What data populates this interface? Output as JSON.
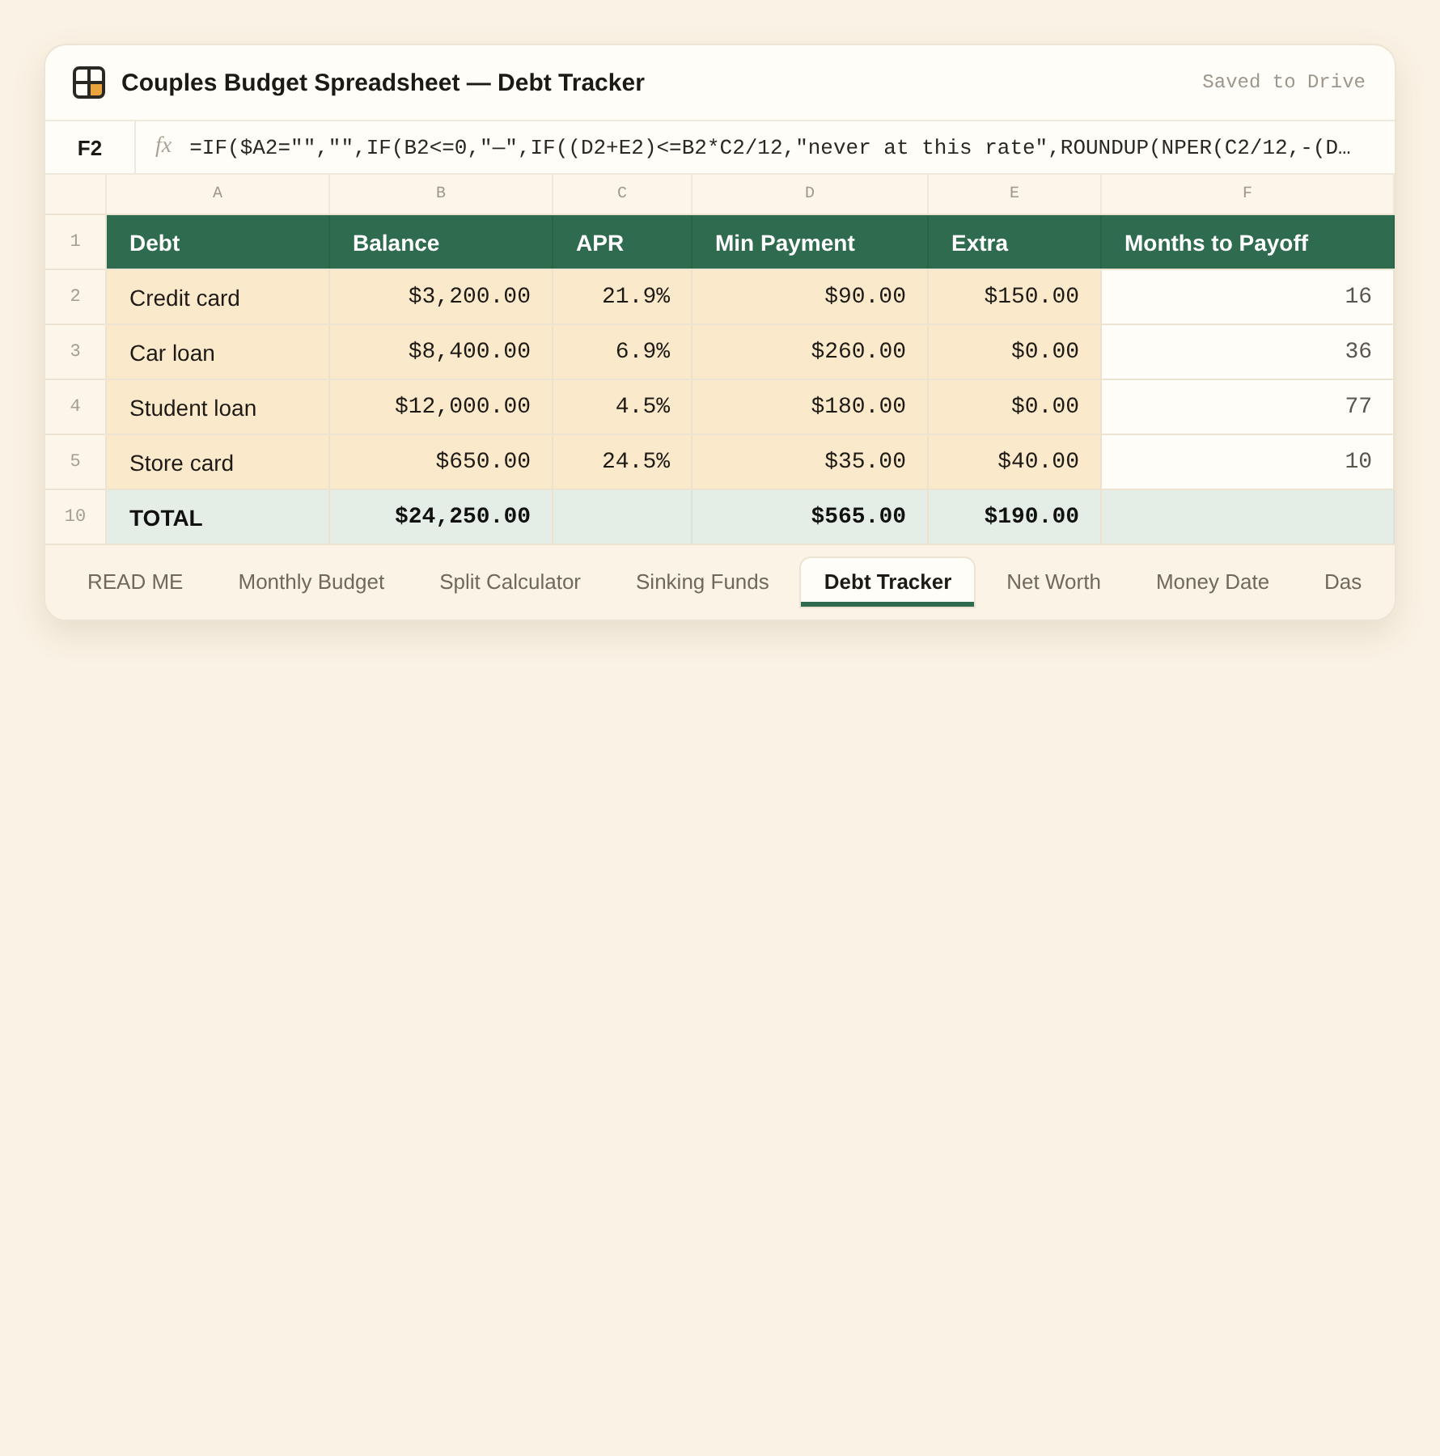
{
  "window": {
    "title": "Couples Budget Spreadsheet — Debt Tracker",
    "status": "Saved to Drive"
  },
  "formula_bar": {
    "cell_ref": "F2",
    "fx_label": "fx",
    "formula": "=IF($A2=\"\",\"\",IF(B2<=0,\"—\",IF((D2+E2)<=B2*C2/12,\"never at this rate\",ROUNDUP(NPER(C2/12,-(D…"
  },
  "sheet": {
    "columns": [
      {
        "letter": "A",
        "header": "Debt",
        "kind": "input"
      },
      {
        "letter": "B",
        "header": "Balance",
        "kind": "input"
      },
      {
        "letter": "C",
        "header": "APR",
        "kind": "input"
      },
      {
        "letter": "D",
        "header": "Min Payment",
        "kind": "input"
      },
      {
        "letter": "E",
        "header": "Extra",
        "kind": "input"
      },
      {
        "letter": "F",
        "header": "Months to Payoff",
        "kind": "formula"
      }
    ],
    "header_row_number": "1",
    "rows": [
      {
        "number": "2",
        "cells": [
          "Credit card",
          "$3,200.00",
          "21.9%",
          "$90.00",
          "$150.00",
          "16"
        ]
      },
      {
        "number": "3",
        "cells": [
          "Car loan",
          "$8,400.00",
          "6.9%",
          "$260.00",
          "$0.00",
          "36"
        ]
      },
      {
        "number": "4",
        "cells": [
          "Student loan",
          "$12,000.00",
          "4.5%",
          "$180.00",
          "$0.00",
          "77"
        ]
      },
      {
        "number": "5",
        "cells": [
          "Store card",
          "$650.00",
          "24.5%",
          "$35.00",
          "$40.00",
          "10"
        ]
      }
    ],
    "total_row": {
      "number": "10",
      "cells": [
        "TOTAL",
        "$24,250.00",
        null,
        "$565.00",
        "$190.00",
        null
      ]
    }
  },
  "tabs": [
    {
      "label": "READ ME",
      "selected": false
    },
    {
      "label": "Monthly Budget",
      "selected": false
    },
    {
      "label": "Split Calculator",
      "selected": false
    },
    {
      "label": "Sinking Funds",
      "selected": false
    },
    {
      "label": "Debt Tracker",
      "selected": true
    },
    {
      "label": "Net Worth",
      "selected": false
    },
    {
      "label": "Money Date",
      "selected": false
    },
    {
      "label": "Das",
      "selected": false
    }
  ]
}
